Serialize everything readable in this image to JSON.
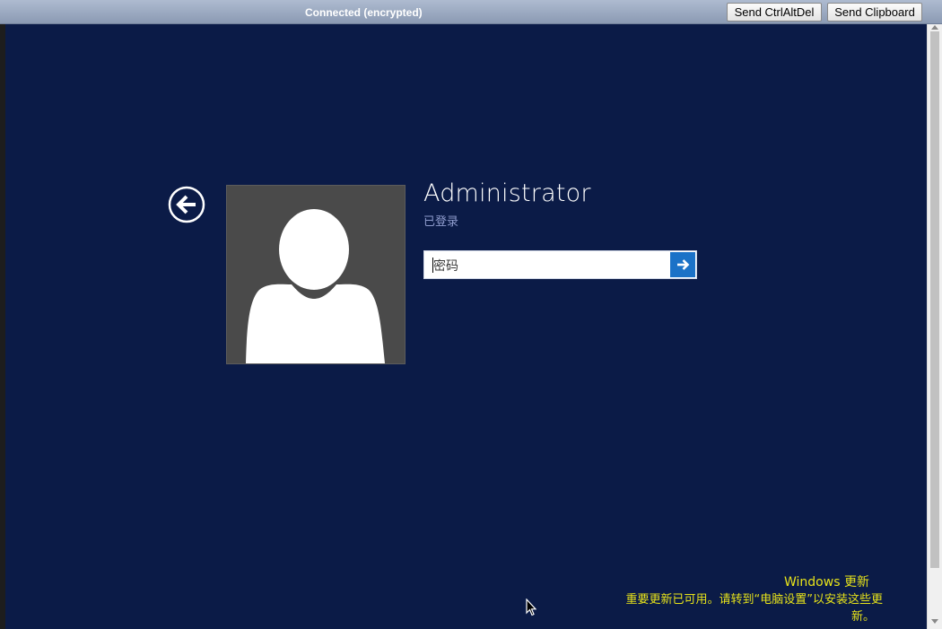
{
  "topbar": {
    "status": "Connected (encrypted)",
    "send_ctrlaltdel": "Send CtrlAltDel",
    "send_clipboard": "Send Clipboard"
  },
  "login": {
    "username": "Administrator",
    "status": "已登录",
    "password_placeholder": "密码",
    "back_icon": "back-arrow-icon",
    "submit_icon": "arrow-right-icon"
  },
  "notification": {
    "title": "Windows 更新",
    "message_line1": "重要更新已可用。请转到“电脑设置”以安装这些更",
    "message_line2": "新。"
  },
  "colors": {
    "background": "#0b1b47",
    "notice_text": "#e7e31a",
    "submit_button": "#1b72c7",
    "avatar_bg": "#4a4a4a"
  }
}
